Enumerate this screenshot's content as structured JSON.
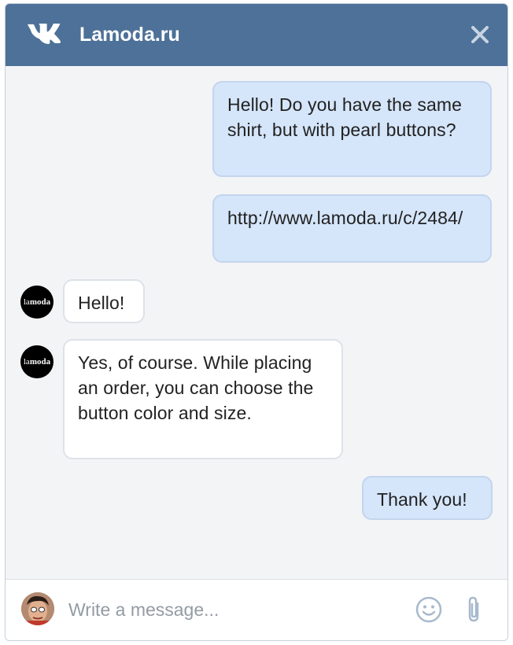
{
  "header": {
    "title": "Lamoda.ru",
    "logo_icon": "vk-logo-icon",
    "close_icon": "close-icon"
  },
  "messages": [
    {
      "direction": "outgoing",
      "text": "Hello! Do you have the same shirt, but with pearl buttons?"
    },
    {
      "direction": "outgoing",
      "text": "http://www.lamoda.ru/c/2484/"
    },
    {
      "direction": "incoming",
      "text": "Hello!"
    },
    {
      "direction": "incoming",
      "text": "Yes, of course. While placing an order, you can choose the button color and size."
    },
    {
      "direction": "outgoing",
      "text": "Thank you!"
    }
  ],
  "lamoda_avatar_text": {
    "light": "la",
    "bold": "moda"
  },
  "composer": {
    "placeholder": "Write a message...",
    "emoji_icon": "emoji-icon",
    "attach_icon": "paperclip-icon"
  },
  "colors": {
    "header_bg": "#4d7198",
    "outgoing_bubble": "#d5e5fa",
    "incoming_bubble": "#ffffff",
    "chat_bg": "#f3f4f6"
  }
}
